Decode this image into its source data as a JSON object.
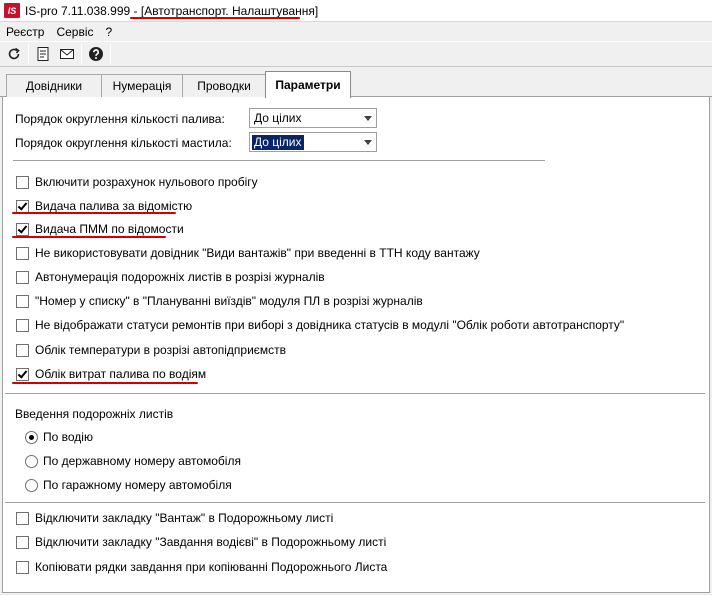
{
  "titlebar": {
    "app_logo": "IS",
    "app_name": "IS-pro 7.11.038.999 - ",
    "module_title": "[Автотранспорт. Налаштування]"
  },
  "menu": [
    "Реєстр",
    "Сервіс",
    "?"
  ],
  "toolbar": {
    "icons": [
      "refresh-icon",
      "document-icon",
      "mail-icon",
      "help-icon"
    ]
  },
  "tabs": [
    {
      "label": "Довідники",
      "active": false
    },
    {
      "label": "Нумерація",
      "active": false
    },
    {
      "label": "Проводки",
      "active": false
    },
    {
      "label": "Параметри",
      "active": true
    }
  ],
  "rounding": {
    "fuel_label": "Порядок округлення кількості палива:",
    "fuel_value": "До цілих",
    "oil_label": "Порядок округлення кількості мастила:",
    "oil_value": "До цілих"
  },
  "checkboxes_top": [
    {
      "label": "Включити розрахунок нульового пробігу",
      "checked": false
    },
    {
      "label": "Видача палива за відомістю",
      "checked": true
    },
    {
      "label": "Видача ПММ по відомости",
      "checked": true
    },
    {
      "label": "Не використовувати довідник \"Види вантажів\" при введенні в ТТН коду вантажу",
      "checked": false
    },
    {
      "label": "Автонумерація подорожніх листів в розрізі журналів",
      "checked": false
    },
    {
      "label": "\"Номер у списку\" в \"Плануванні виїздів\" модуля ПЛ в розрізі журналів",
      "checked": false
    },
    {
      "label": "Не відображати статуси ремонтів при виборі з довідника статусів в модулі \"Облік роботи автотранспорту\"",
      "checked": false
    },
    {
      "label": "Облік температури в розрізі автопідприємств",
      "checked": false
    },
    {
      "label": "Облік витрат палива по водіям",
      "checked": true
    }
  ],
  "waybill_entry": {
    "title": "Введення подорожніх листів",
    "options": [
      {
        "label": "По водію",
        "selected": true
      },
      {
        "label": "По державному номеру автомобіля",
        "selected": false
      },
      {
        "label": "По гаражному номеру автомобіля",
        "selected": false
      }
    ]
  },
  "checkboxes_bottom": [
    {
      "label": "Відключити закладку \"Вантаж\" в Подорожньому листі",
      "checked": false
    },
    {
      "label": "Відключити закладку \"Завдання водієві\" в Подорожньому листі",
      "checked": false
    },
    {
      "label": "Копіювати рядки завдання при копіюванні Подорожнього Листа",
      "checked": false
    }
  ],
  "colors": {
    "annotation_red": "#d40000",
    "selection_blue": "#0a246a",
    "logo_red": "#c8102e"
  }
}
